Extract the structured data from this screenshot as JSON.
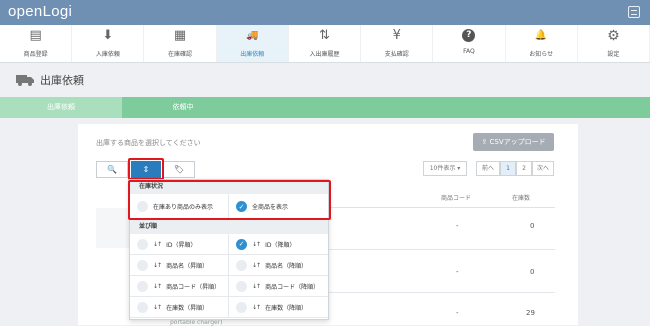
{
  "app": {
    "logo": "openLogi"
  },
  "nav": [
    {
      "label": "商品登録",
      "icon": "product-register-icon",
      "glyph": "▤"
    },
    {
      "label": "入庫依頼",
      "icon": "inbound-icon",
      "glyph": "⬇"
    },
    {
      "label": "在庫確認",
      "icon": "inventory-icon",
      "glyph": "▦"
    },
    {
      "label": "出庫依頼",
      "icon": "truck-icon",
      "glyph": "🚚",
      "active": true
    },
    {
      "label": "入出庫履歴",
      "icon": "history-icon",
      "glyph": "⇅"
    },
    {
      "label": "支払確認",
      "icon": "yen-icon",
      "glyph": "¥"
    },
    {
      "label": "FAQ",
      "icon": "faq-icon",
      "glyph": "?"
    },
    {
      "label": "お知らせ",
      "icon": "bell-icon",
      "glyph": "🔔"
    },
    {
      "label": "設定",
      "icon": "gear-icon",
      "glyph": "⚙"
    }
  ],
  "page": {
    "title": "出庫依頼"
  },
  "steps": [
    "出庫依頼",
    "依頼中"
  ],
  "main": {
    "instruction": "出庫する商品を選択してください",
    "csv_button": "CSVアップロード",
    "per_page": "10件表示",
    "prev": "前へ",
    "page_1": "1",
    "page_2": "2",
    "next": "次へ"
  },
  "table": {
    "col_code": "商品コード",
    "col_stock": "在庫数",
    "rows": [
      {
        "code": "-",
        "stock": "0"
      },
      {
        "code": "-",
        "stock": "0"
      },
      {
        "code": "-",
        "stock": "29"
      }
    ],
    "partial_text": "portable charger)"
  },
  "dropdown": {
    "stock_section": "在庫状況",
    "stock_options": [
      {
        "label": "在庫あり商品のみ表示",
        "selected": false
      },
      {
        "label": "全商品を表示",
        "selected": true
      }
    ],
    "sort_section": "並び順",
    "sort_options": [
      {
        "label": "ID（昇順）",
        "selected": false
      },
      {
        "label": "ID（降順）",
        "selected": true
      },
      {
        "label": "商品名（昇順）",
        "selected": false
      },
      {
        "label": "商品名（降順）",
        "selected": false
      },
      {
        "label": "商品コード（昇順）",
        "selected": false
      },
      {
        "label": "商品コード（降順）",
        "selected": false
      },
      {
        "label": "在庫数（昇順）",
        "selected": false
      },
      {
        "label": "在庫数（降順）",
        "selected": false
      }
    ]
  },
  "colors": {
    "topbar": "#6f8fb3",
    "accent": "#2f8fcf",
    "steps": "#7ecb9b",
    "highlight": "#e0171f"
  }
}
